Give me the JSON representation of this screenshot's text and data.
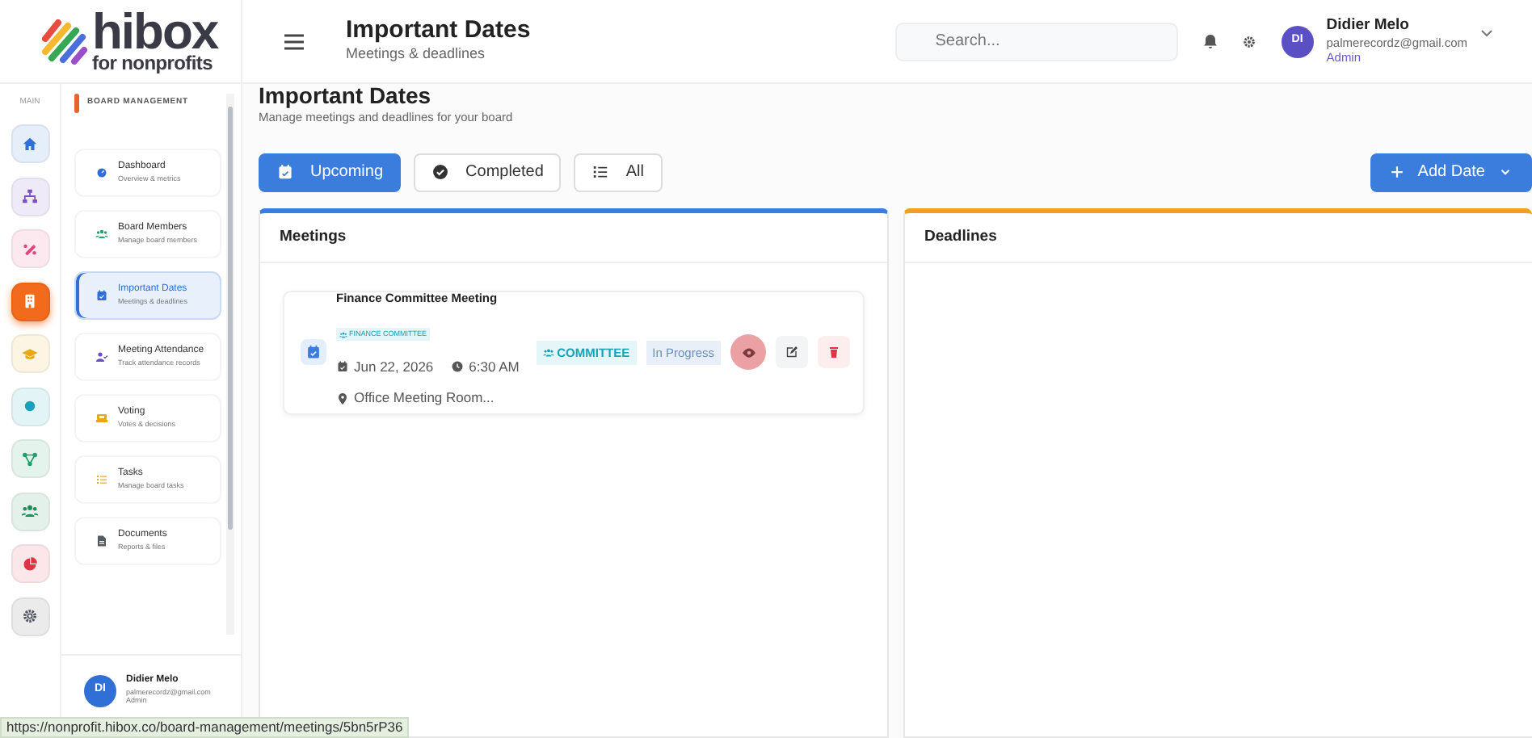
{
  "logo": {
    "name": "hibox",
    "tagline": "for nonprofits"
  },
  "header": {
    "title": "Important Dates",
    "subtitle": "Meetings & deadlines"
  },
  "search": {
    "placeholder": "Search..."
  },
  "user": {
    "initials": "DI",
    "name": "Didier Melo",
    "email": "palmerecordz@gmail.com",
    "role": "Admin"
  },
  "rail": {
    "label": "MAIN",
    "items": [
      {
        "kind": "home",
        "color": "#2f6fd6",
        "selected": false
      },
      {
        "kind": "sitemap",
        "color": "#7b4fc4",
        "selected": false
      },
      {
        "kind": "pill",
        "color": "#e0457b",
        "selected": false
      },
      {
        "kind": "building",
        "color": "#f26a1b",
        "selected": true
      },
      {
        "kind": "graduation",
        "color": "#e6a817",
        "selected": false
      },
      {
        "kind": "circle",
        "color": "#17a2b8",
        "selected": false
      },
      {
        "kind": "share",
        "color": "#22a06b",
        "selected": false
      },
      {
        "kind": "people",
        "color": "#1e8e5a",
        "selected": false
      },
      {
        "kind": "pie",
        "color": "#dc3545",
        "selected": false
      },
      {
        "kind": "gear",
        "color": "#555b63",
        "selected": false
      }
    ]
  },
  "section": {
    "title": "BOARD MANAGEMENT"
  },
  "nav": [
    {
      "kind": "gauge",
      "color": "#2f6fd6",
      "title": "Dashboard",
      "subtitle": "Overview & metrics",
      "selected": false
    },
    {
      "kind": "people",
      "color": "#22a06b",
      "title": "Board Members",
      "subtitle": "Manage board members",
      "selected": false
    },
    {
      "kind": "calendar",
      "color": "#2f6fd6",
      "title": "Important Dates",
      "subtitle": "Meetings & deadlines",
      "selected": true
    },
    {
      "kind": "usercheck",
      "color": "#6a4fc4",
      "title": "Meeting Attendance",
      "subtitle": "Track attendance records",
      "selected": false
    },
    {
      "kind": "box",
      "color": "#e6a817",
      "title": "Voting",
      "subtitle": "Votes & decisions",
      "selected": false
    },
    {
      "kind": "list",
      "color": "#e6a817",
      "title": "Tasks",
      "subtitle": "Manage board tasks",
      "selected": false
    },
    {
      "kind": "file",
      "color": "#555b63",
      "title": "Documents",
      "subtitle": "Reports & files",
      "selected": false
    }
  ],
  "sidebar_user": {
    "initials": "DI",
    "name": "Didier Melo",
    "email": "palmerecordz@gmail.com",
    "role": "Admin"
  },
  "page": {
    "title": "Important Dates",
    "subtitle": "Manage meetings and deadlines for your board"
  },
  "filters": [
    {
      "kind": "calendar",
      "label": "Upcoming",
      "selected": true
    },
    {
      "kind": "check",
      "label": "Completed",
      "selected": false
    },
    {
      "kind": "list",
      "label": "All",
      "selected": false
    }
  ],
  "add_button": {
    "label": "Add Date"
  },
  "panels": [
    {
      "title": "Meetings",
      "color": "#3b7ddd",
      "meetings": [
        {
          "title": "Finance Committee Meeting",
          "committee": "FINANCE COMMITTEE",
          "date": "Jun 22, 2026",
          "time": "6:30 AM",
          "location": "Office Meeting Room...",
          "type": "COMMITTEE",
          "status": "In Progress"
        }
      ]
    },
    {
      "title": "Deadlines",
      "color": "#f0a020"
    }
  ],
  "status_url": "https://nonprofit.hibox.co/board-management/meetings/5bn5rP36"
}
